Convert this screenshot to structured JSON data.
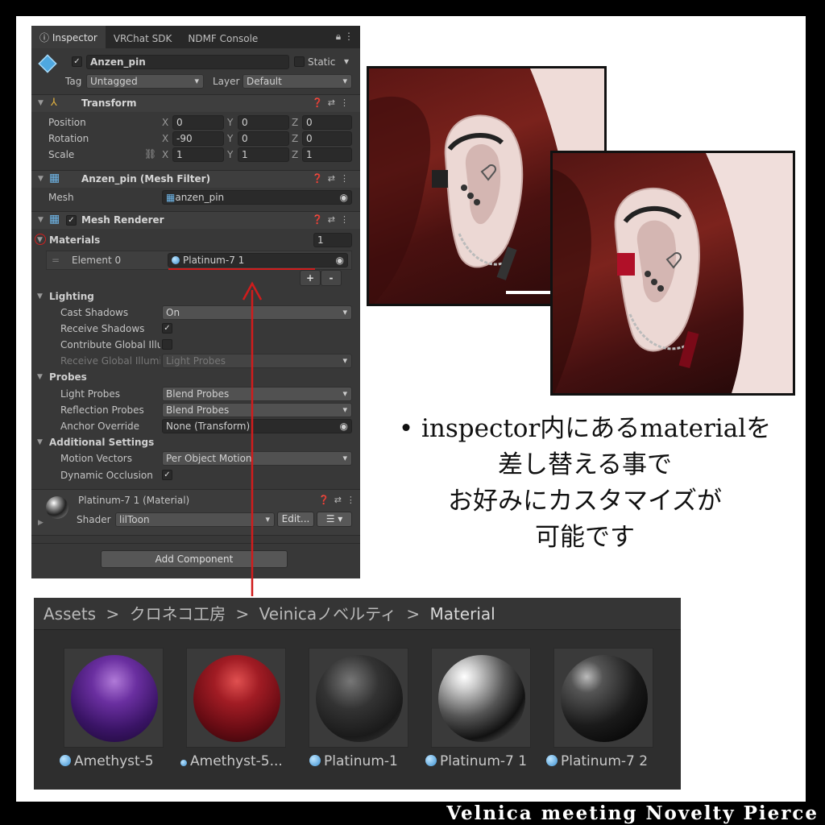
{
  "inspector": {
    "tabs": [
      "Inspector",
      "VRChat SDK",
      "NDMF Console"
    ],
    "object_name": "Anzen_pin",
    "static_label": "Static",
    "tag_label": "Tag",
    "tag_value": "Untagged",
    "layer_label": "Layer",
    "layer_value": "Default",
    "transform": {
      "title": "Transform",
      "position_label": "Position",
      "rotation_label": "Rotation",
      "scale_label": "Scale",
      "position": [
        "0",
        "0",
        "0"
      ],
      "rotation": [
        "-90",
        "0",
        "0"
      ],
      "scale": [
        "1",
        "1",
        "1"
      ],
      "axes": [
        "X",
        "Y",
        "Z"
      ]
    },
    "mesh_filter": {
      "title": "Anzen_pin (Mesh Filter)",
      "mesh_label": "Mesh",
      "mesh_value": "anzen_pin"
    },
    "mesh_renderer": {
      "title": "Mesh Renderer",
      "materials_label": "Materials",
      "materials_count": "1",
      "element_label": "Element 0",
      "element_value": "Platinum-7 1",
      "plus": "+",
      "minus": "-",
      "lighting_label": "Lighting",
      "cast_shadows_label": "Cast Shadows",
      "cast_shadows_value": "On",
      "receive_shadows_label": "Receive Shadows",
      "contribute_gi_label": "Contribute Global Illum",
      "receive_gi_label": "Receive Global Illumin",
      "receive_gi_value": "Light Probes",
      "probes_label": "Probes",
      "light_probes_label": "Light Probes",
      "light_probes_value": "Blend Probes",
      "reflection_probes_label": "Reflection Probes",
      "reflection_probes_value": "Blend Probes",
      "anchor_override_label": "Anchor Override",
      "anchor_override_value": "None (Transform)",
      "additional_label": "Additional Settings",
      "motion_vectors_label": "Motion Vectors",
      "motion_vectors_value": "Per Object Motion",
      "dynamic_occlusion_label": "Dynamic Occlusion"
    },
    "material": {
      "title": "Platinum-7 1 (Material)",
      "shader_label": "Shader",
      "shader_value": "lilToon",
      "edit_label": "Edit..."
    },
    "add_component": "Add Component"
  },
  "description": {
    "line1": "• inspector内にあるmaterialを",
    "line2": "差し替える事で",
    "line3": "お好みにカスタマイズが",
    "line4": "可能です"
  },
  "assets": {
    "breadcrumb": [
      "Assets",
      "クロネコ工房",
      "Veinicaノベルティ",
      "Material"
    ],
    "separator": ">",
    "items": [
      {
        "name": "Amethyst-5",
        "color": "#5a2a8a"
      },
      {
        "name": "Amethyst-5...",
        "color": "#8a1f24"
      },
      {
        "name": "Platinum-1",
        "color": "#2a2a2a"
      },
      {
        "name": "Platinum-7 1",
        "color": "#9a9a9a"
      },
      {
        "name": "Platinum-7 2",
        "color": "#3a3a3a"
      }
    ]
  },
  "footer": "Velnica meeting  Novelty Pierce",
  "colors": {
    "arrow": "#d01c1c",
    "inspector_bg": "#383838",
    "assets_bg": "#2e2e2e"
  }
}
